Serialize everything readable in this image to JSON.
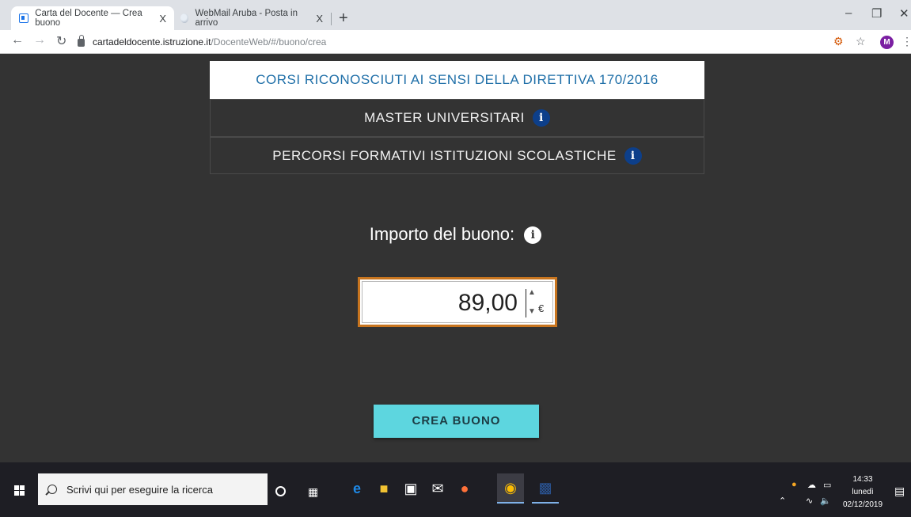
{
  "browser": {
    "tabs": [
      {
        "title": "Carta del Docente — Crea buono",
        "close": "X",
        "active": true
      },
      {
        "title": "WebMail Aruba - Posta in arrivo",
        "close": "X",
        "active": false
      }
    ],
    "new_tab": "+",
    "url_host": "cartadeldocente.istruzione.it",
    "url_path": "/DocenteWeb/#/buono/crea",
    "profile_initial": "M"
  },
  "page": {
    "options": [
      {
        "label": "CORSI RICONOSCIUTI AI SENSI DELLA DIRETTIVA 170/2016",
        "selected": true,
        "info": false
      },
      {
        "label": "MASTER UNIVERSITARI",
        "selected": false,
        "info": true
      },
      {
        "label": "PERCORSI FORMATIVI ISTITUZIONI SCOLASTICHE",
        "selected": false,
        "info": true
      }
    ],
    "info_glyph": "i",
    "amount_label": "Importo del buono:",
    "amount_value": "89,00",
    "currency": "€",
    "submit_label": "CREA BUONO"
  },
  "taskbar": {
    "search_placeholder": "Scrivi qui per eseguire la ricerca",
    "time": "14:33",
    "day": "lunedì",
    "date": "02/12/2019"
  },
  "colors": {
    "page_bg": "#333333",
    "selected_text": "#1f6fa8",
    "button_bg": "#5dd6df",
    "input_border": "#c8751f",
    "info_badge": "#0d3f8a"
  }
}
